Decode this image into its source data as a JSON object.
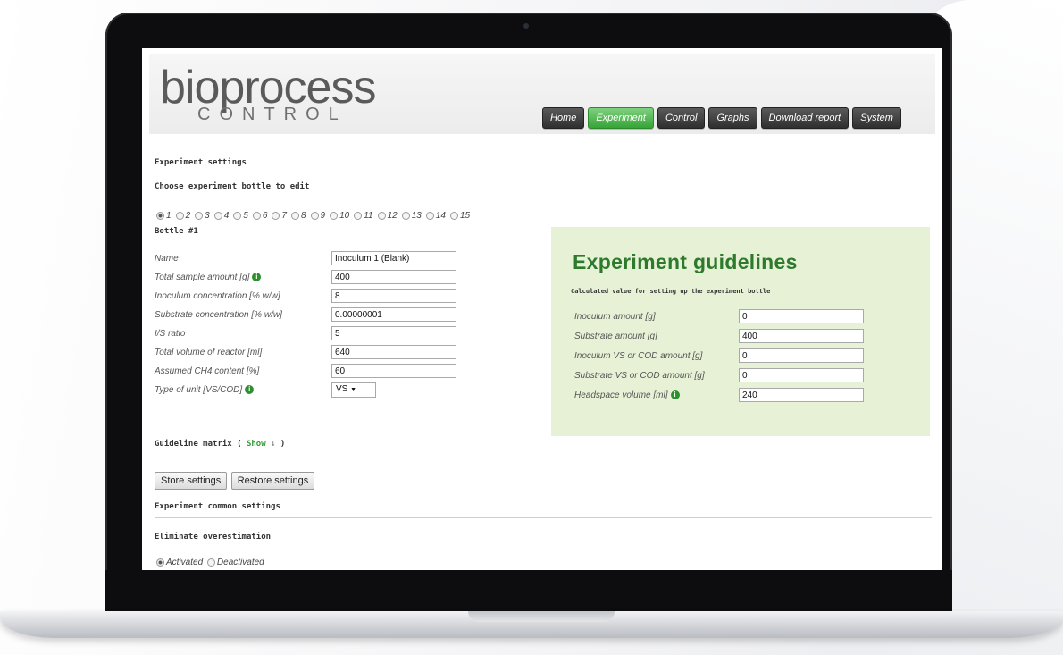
{
  "logo": {
    "top": "bioprocess",
    "bottom": "CONTROL"
  },
  "nav": [
    "Home",
    "Experiment",
    "Control",
    "Graphs",
    "Download report",
    "System"
  ],
  "experiment_settings": {
    "title": "Experiment settings",
    "choose_label": "Choose experiment bottle to edit",
    "bottles": [
      "1",
      "2",
      "3",
      "4",
      "5",
      "6",
      "7",
      "8",
      "9",
      "10",
      "11",
      "12",
      "13",
      "14",
      "15"
    ],
    "selected_bottle": "1",
    "bottle_title": "Bottle #1",
    "fields": [
      {
        "label": "Name",
        "value": "Inoculum 1 (Blank)"
      },
      {
        "label": "Total sample amount [g]",
        "value": "400"
      },
      {
        "label": "Inoculum concentration [% w/w]",
        "value": "8"
      },
      {
        "label": "Substrate concentration [% w/w]",
        "value": "0.00000001"
      },
      {
        "label": "I/S ratio",
        "value": "5"
      },
      {
        "label": "Total volume of reactor [ml]",
        "value": "640"
      },
      {
        "label": "Assumed CH4 content [%]",
        "value": "60"
      },
      {
        "label": "Type of unit [VS/COD]",
        "value": "VS"
      }
    ],
    "guideline_matrix": {
      "label": "Guideline matrix (",
      "link": "Show",
      "arrow": "↓",
      "end": ")"
    },
    "store_button": "Store settings",
    "restore_button": "Restore settings"
  },
  "guidelines": {
    "title": "Experiment guidelines",
    "subtitle": "Calculated value for setting up the experiment bottle",
    "fields": [
      {
        "label": "Inoculum amount [g]",
        "value": "0"
      },
      {
        "label": "Substrate amount [g]",
        "value": "400"
      },
      {
        "label": "Inoculum VS or COD amount [g]",
        "value": "0"
      },
      {
        "label": "Substrate VS or COD amount [g]",
        "value": "0"
      },
      {
        "label": "Headspace volume [ml]",
        "value": "240"
      }
    ]
  },
  "common_settings": {
    "title": "Experiment common settings",
    "eliminate_label": "Eliminate overestimation",
    "options": [
      "Activated",
      "Deactivated"
    ],
    "selected": "Activated"
  },
  "colors": {
    "accent_green": "#37a437",
    "panel_green": "#e7f1d6",
    "title_green": "#2d7a2d"
  },
  "icons": [
    "info-icon",
    "dropdown-arrow-icon",
    "radio-button"
  ]
}
